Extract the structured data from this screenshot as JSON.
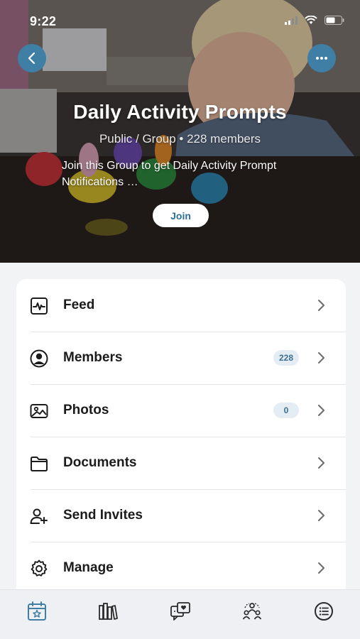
{
  "status": {
    "time": "9:22"
  },
  "group": {
    "title": "Daily Activity Prompts",
    "subtitle": "Public / Group • 228 members",
    "description": "Join this Group to get Daily Activity Prompt Notifications …",
    "join_label": "Join"
  },
  "menu": {
    "items": [
      {
        "label": "Feed",
        "icon": "activity-icon"
      },
      {
        "label": "Members",
        "icon": "person-circle-icon",
        "badge": "228"
      },
      {
        "label": "Photos",
        "icon": "photo-icon",
        "badge": "0"
      },
      {
        "label": "Documents",
        "icon": "folder-icon"
      },
      {
        "label": "Send Invites",
        "icon": "add-person-icon"
      },
      {
        "label": "Manage",
        "icon": "gear-icon"
      }
    ]
  },
  "tabs": [
    {
      "icon": "calendar-star-icon",
      "active": true
    },
    {
      "icon": "books-icon"
    },
    {
      "icon": "chat-heart-icon"
    },
    {
      "icon": "community-icon"
    },
    {
      "icon": "menu-list-icon"
    }
  ],
  "colors": {
    "accent": "#3f7fa6",
    "badge_bg": "#e4edf3",
    "badge_text": "#3d6f8e",
    "tab_active": "#3f7fa6",
    "tab_inactive": "#2a2a2a"
  }
}
